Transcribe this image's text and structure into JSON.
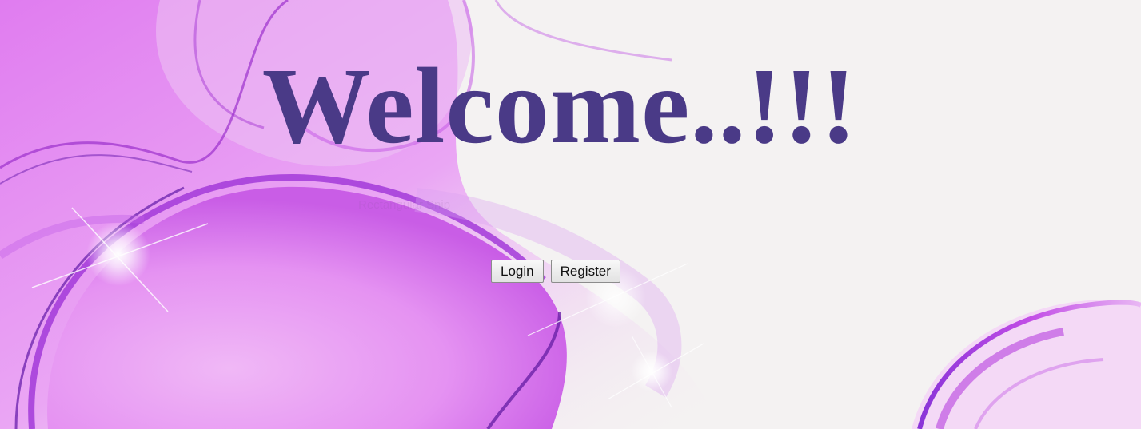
{
  "page": {
    "heading": "Welcome..!!!",
    "ghost_text": "Rectangular Snip"
  },
  "actions": {
    "login_label": "Login",
    "register_label": "Register"
  },
  "colors": {
    "heading": "#4a3a87",
    "background_light": "#f4f2f2",
    "accent_magenta": "#c84be6",
    "accent_purple": "#9a46d6"
  }
}
